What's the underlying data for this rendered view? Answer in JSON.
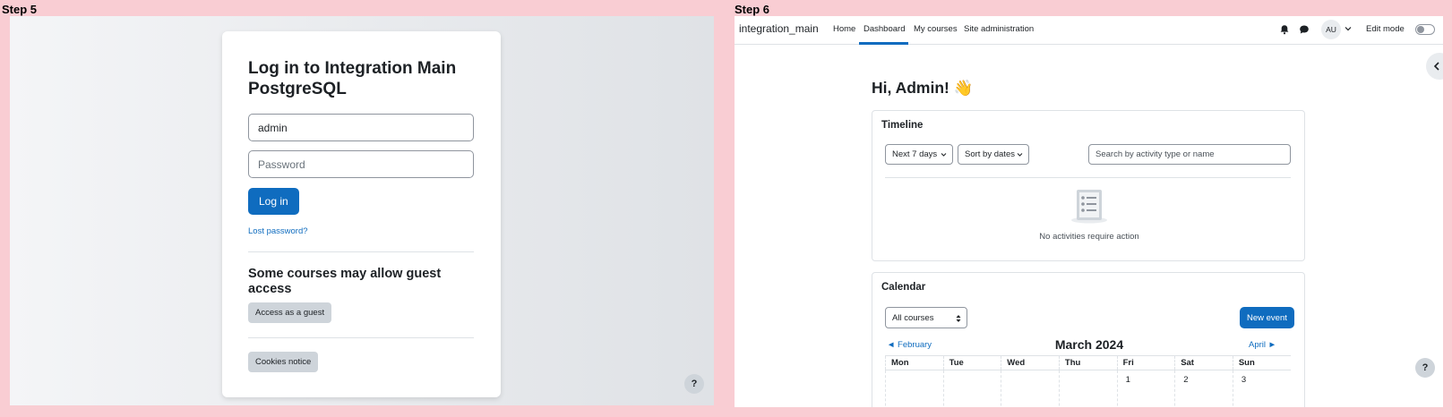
{
  "steps": {
    "step5": "Step 5",
    "step6": "Step 6"
  },
  "login": {
    "title": "Log in to Integration Main PostgreSQL",
    "username_value": "admin",
    "password_placeholder": "Password",
    "login_button": "Log in",
    "lost_password": "Lost password?",
    "guest_heading": "Some courses may allow guest access",
    "guest_button": "Access as a guest",
    "cookies_button": "Cookies notice",
    "help": "?"
  },
  "dashboard": {
    "brand": "integration_main",
    "nav": [
      "Home",
      "Dashboard",
      "My courses",
      "Site administration"
    ],
    "avatar": "AU",
    "edit_mode": "Edit mode",
    "greeting": "Hi, Admin! 👋",
    "timeline": {
      "title": "Timeline",
      "filter_days": "Next 7 days",
      "sort": "Sort by dates",
      "search_placeholder": "Search by activity type or name",
      "empty": "No activities require action"
    },
    "calendar": {
      "title": "Calendar",
      "course_select": "All courses",
      "new_event": "New event",
      "prev": "◄ February",
      "next": "April ►",
      "month": "March 2024",
      "days": [
        "Mon",
        "Tue",
        "Wed",
        "Thu",
        "Fri",
        "Sat",
        "Sun"
      ],
      "first_week": [
        "",
        "",
        "",
        "",
        "1",
        "2",
        "3"
      ]
    },
    "help": "?"
  }
}
